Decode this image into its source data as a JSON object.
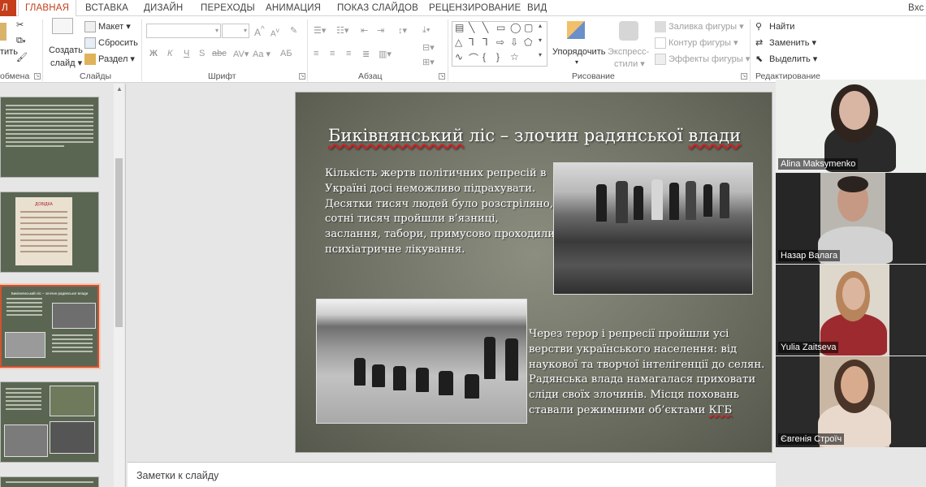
{
  "tabs": {
    "file": "Л",
    "home": "ГЛАВНАЯ",
    "insert": "ВСТАВКА",
    "design": "ДИЗАЙН",
    "transitions": "ПЕРЕХОДЫ",
    "animation": "АНИМАЦИЯ",
    "slideshow": "ПОКАЗ СЛАЙДОВ",
    "review": "РЕЦЕНЗИРОВАНИЕ",
    "view": "ВИД",
    "signin": "Вхс"
  },
  "ribbon": {
    "clipboard": {
      "paste": "тить",
      "label": "обмена"
    },
    "slides": {
      "create": "Создать",
      "create2": "слайд",
      "layout": "Макет",
      "reset": "Сбросить",
      "section": "Раздел",
      "label": "Слайды"
    },
    "font": {
      "bold": "Ж",
      "italic": "К",
      "underline": "Ч",
      "strike": "S",
      "spacing": "abc",
      "grow": "A",
      "shrink": "A",
      "case": "Aa",
      "change": "АБ",
      "label": "Шрифт"
    },
    "paragraph": {
      "label": "Абзац"
    },
    "drawing": {
      "arrange": "Упорядочить",
      "styles": "Экспресс-",
      "styles2": "стили",
      "fill": "Заливка фигуры",
      "outline": "Контур фигуры",
      "effects": "Эффекты фигуры",
      "label": "Рисование"
    },
    "editing": {
      "find": "Найти",
      "replace": "Заменить",
      "select": "Выделить",
      "label": "Редактирование"
    }
  },
  "slide": {
    "title_a": "Биківнянський",
    "title_b": " ліс – злочин радянської ",
    "title_c": "влади",
    "paragraph1": "Кількість жертв політичних репресій в Україні досі неможливо підрахувати. Десятки тисяч людей було розстріляно, сотні тисяч пройшли в’язниці, заслання, табори, примусово проходили психіатричне лікування.",
    "paragraph2_a": "Через терор і репресії пройшли усі верстви українського населення: від наукової та творчої інтелігенції до селян. Радянська влада намагалася приховати сліди своїх злочинів. Місця поховань ставали режимними об’єктами ",
    "paragraph2_b": "КГБ"
  },
  "thumbs": {
    "slide3_title": "Биківнянський ліс – злочин радянської влади",
    "slide2_title": "ДОВІДКА"
  },
  "notes": {
    "placeholder": "Заметки к слайду"
  },
  "participants": [
    "Alina Maksymenko",
    "Назар Валага",
    "Yulia Zaitseva",
    "Євгенія Строїч"
  ],
  "colors": {
    "accent": "#c43e1c",
    "speaker_highlight": "#4bd14b"
  }
}
